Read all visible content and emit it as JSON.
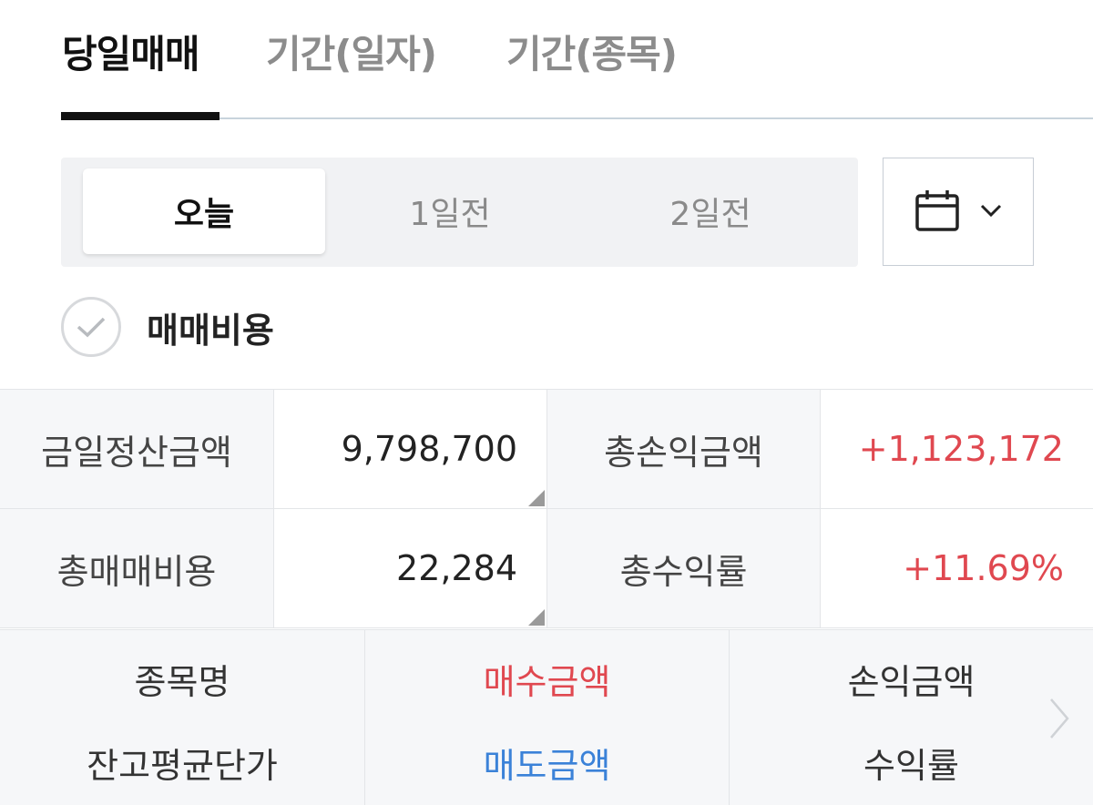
{
  "tabs": [
    {
      "label": "당일매매"
    },
    {
      "label": "기간(일자)"
    },
    {
      "label": "기간(종목)"
    }
  ],
  "period": {
    "options": [
      "오늘",
      "1일전",
      "2일전"
    ],
    "selected": "오늘"
  },
  "icons": {
    "calendar": "calendar-icon",
    "dropdown": "chevron-down-icon",
    "check": "check-icon",
    "more": "chevron-right-icon"
  },
  "fee": {
    "label": "매매비용",
    "checked": false
  },
  "summary": {
    "settlement_label": "금일정산금액",
    "settlement_value": "9,798,700",
    "total_pnl_label": "총손익금액",
    "total_pnl_value": "+1,123,172",
    "total_fee_label": "총매매비용",
    "total_fee_value": "22,284",
    "total_return_label": "총수익률",
    "total_return_value": "+11.69%"
  },
  "columns": {
    "stock_name": "종목명",
    "avg_price": "잔고평균단가",
    "buy_amount": "매수금액",
    "sell_amount": "매도금액",
    "pnl_amount": "손익금액",
    "return_rate": "수익률"
  },
  "colors": {
    "positive": "#e04850",
    "buy": "#e04850",
    "sell": "#3b82d8",
    "active_tab": "#111111",
    "inactive_tab": "#8c8c8c"
  }
}
